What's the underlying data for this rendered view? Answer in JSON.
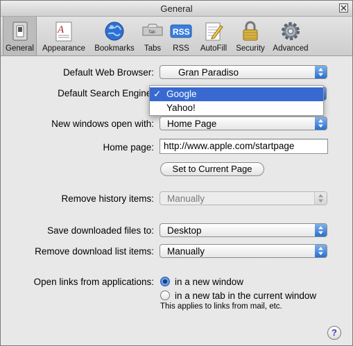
{
  "window": {
    "title": "General"
  },
  "toolbar": {
    "items": [
      {
        "label": "General",
        "icon": "switch-icon"
      },
      {
        "label": "Appearance",
        "icon": "font-icon"
      },
      {
        "label": "Bookmarks",
        "icon": "globe-icon"
      },
      {
        "label": "Tabs",
        "icon": "tab-icon"
      },
      {
        "label": "RSS",
        "icon": "rss-icon"
      },
      {
        "label": "AutoFill",
        "icon": "pencil-icon"
      },
      {
        "label": "Security",
        "icon": "lock-icon"
      },
      {
        "label": "Advanced",
        "icon": "gear-icon"
      }
    ]
  },
  "settings": {
    "default_browser": {
      "label": "Default Web Browser:",
      "value": "Gran Paradiso"
    },
    "default_search": {
      "label": "Default Search Engine:",
      "options": [
        "Google",
        "Yahoo!"
      ],
      "selected": "Google"
    },
    "new_windows": {
      "label": "New windows open with:",
      "value": "Home Page"
    },
    "home_page": {
      "label": "Home page:",
      "value": "http://www.apple.com/startpage"
    },
    "set_current_button": "Set to Current Page",
    "remove_history": {
      "label": "Remove history items:",
      "value": "Manually"
    },
    "save_downloads": {
      "label": "Save downloaded files to:",
      "value": "Desktop"
    },
    "remove_download_list": {
      "label": "Remove download list items:",
      "value": "Manually"
    },
    "open_links": {
      "label": "Open links from applications:",
      "option_window": "in a new window",
      "option_tab": "in a new tab in the current window",
      "note": "This applies to links from mail, etc."
    },
    "help_label": "?"
  },
  "colors": {
    "accent": "#3769d0",
    "popup_arrow": "#2a6fd1"
  }
}
